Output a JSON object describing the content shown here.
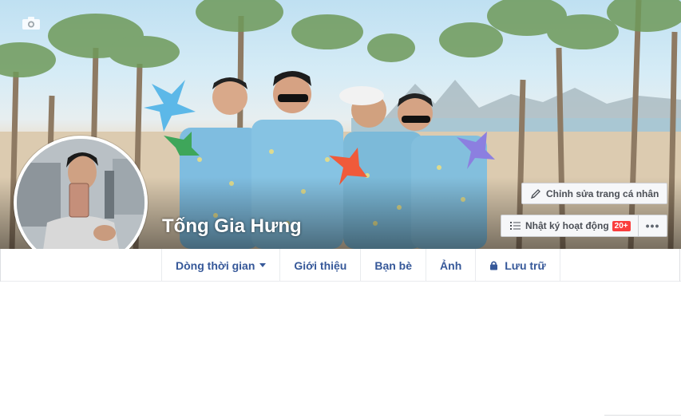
{
  "profile": {
    "name": "Tống Gia Hưng"
  },
  "actions": {
    "edit_profile": "Chỉnh sửa trang cá nhân",
    "activity_log": "Nhật ký hoạt động",
    "activity_badge": "20+",
    "more": "•••"
  },
  "tabs": [
    {
      "label": "Dòng thời gian",
      "has_caret": true
    },
    {
      "label": "Giới thiệu"
    },
    {
      "label": "Bạn bè"
    },
    {
      "label": "Ảnh"
    },
    {
      "label": "Lưu trữ",
      "icon": "lock-icon"
    }
  ],
  "icons": {
    "cover_camera": "camera-icon",
    "edit": "pencil-icon",
    "activity": "list-icon",
    "more": "more-dots-icon"
  },
  "colors": {
    "link_blue": "#365899",
    "badge_red": "#fa3e3e",
    "button_bg": "#f6f7f9",
    "button_text": "#4b4f56"
  }
}
